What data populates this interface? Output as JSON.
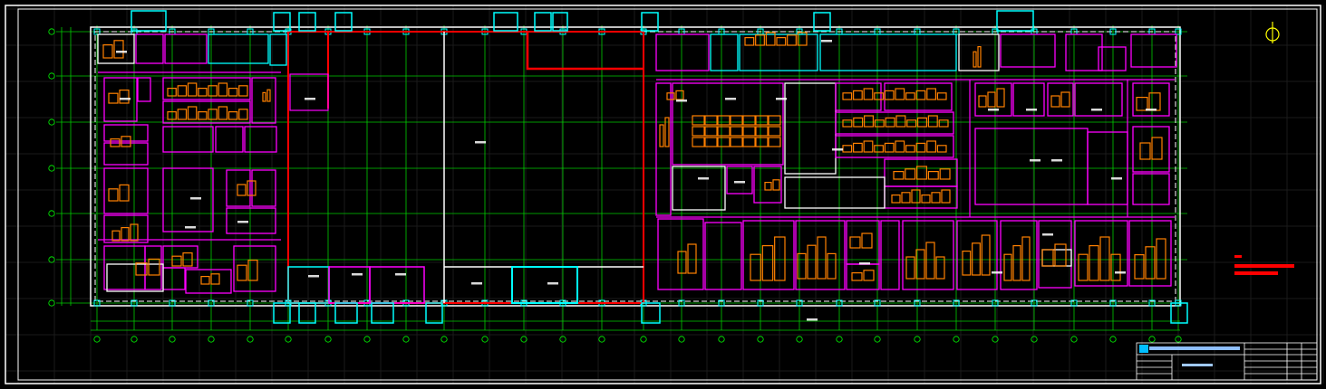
{
  "drawing": {
    "background": "#000000",
    "colors": {
      "frame": "#ffffff",
      "grid": "#00ff00",
      "wall_outline": "#ffffff",
      "room_magenta": "#ff00ff",
      "room_cyan": "#00ffff",
      "zone_red": "#ff0000",
      "equipment": "#ff8000",
      "label": "#ffffff",
      "north": "#ffff00",
      "legend": "#ff0000"
    },
    "north_arrow": {
      "icon": "north-arrow-icon"
    },
    "legend": {
      "entries": 3
    }
  },
  "title_block": {
    "company": "",
    "drawing_title": "",
    "logo_icon": "company-logo-icon"
  }
}
